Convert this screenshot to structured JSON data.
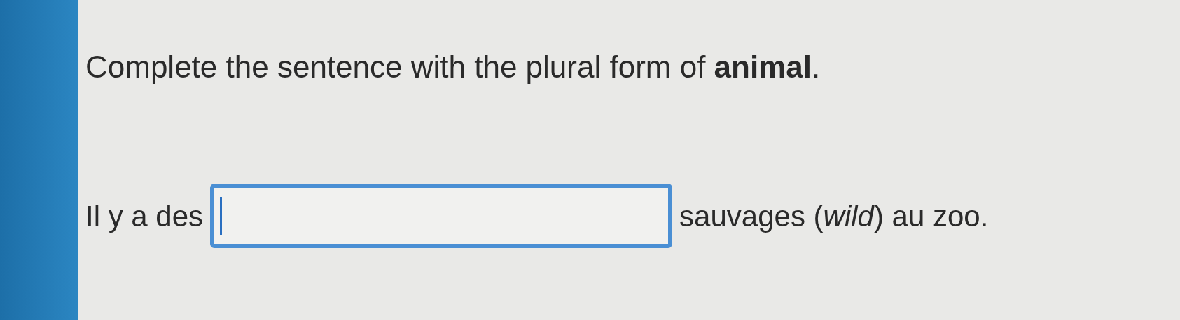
{
  "prompt": "Complete the sentence with the plural form of **animal**.",
  "sentence": {
    "before": "Il y a des",
    "answer": {
      "focused": true
    },
    "after": "sauvages (*wild*) au zoo."
  }
}
